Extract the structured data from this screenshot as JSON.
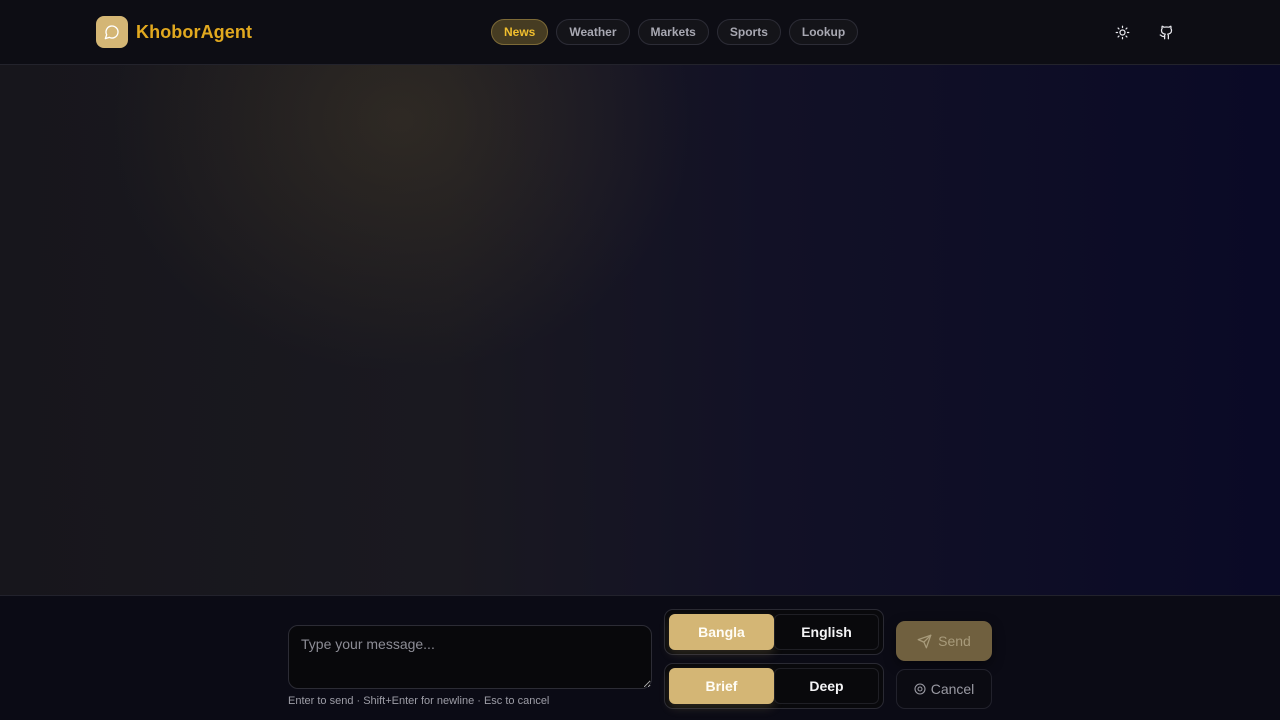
{
  "app": {
    "brand_name": "KhoborAgent",
    "logo_icon": "chat-bubble-icon",
    "brand_color": "#e2a91f",
    "accent_color": "#d4b675"
  },
  "nav": {
    "items": [
      {
        "label": "News",
        "active": true
      },
      {
        "label": "Weather",
        "active": false
      },
      {
        "label": "Markets",
        "active": false
      },
      {
        "label": "Sports",
        "active": false
      },
      {
        "label": "Lookup",
        "active": false
      }
    ]
  },
  "header_actions": {
    "theme_icon": "sun-icon",
    "repo_icon": "github-icon"
  },
  "composer": {
    "placeholder": "Type your message...",
    "value": "",
    "hint": "Enter to send · Shift+Enter for newline · Esc to cancel",
    "language": {
      "options": [
        "Bangla",
        "English"
      ],
      "selected": "Bangla"
    },
    "depth": {
      "options": [
        "Brief",
        "Deep"
      ],
      "selected": "Brief"
    },
    "send_label": "Send",
    "cancel_label": "Cancel"
  }
}
